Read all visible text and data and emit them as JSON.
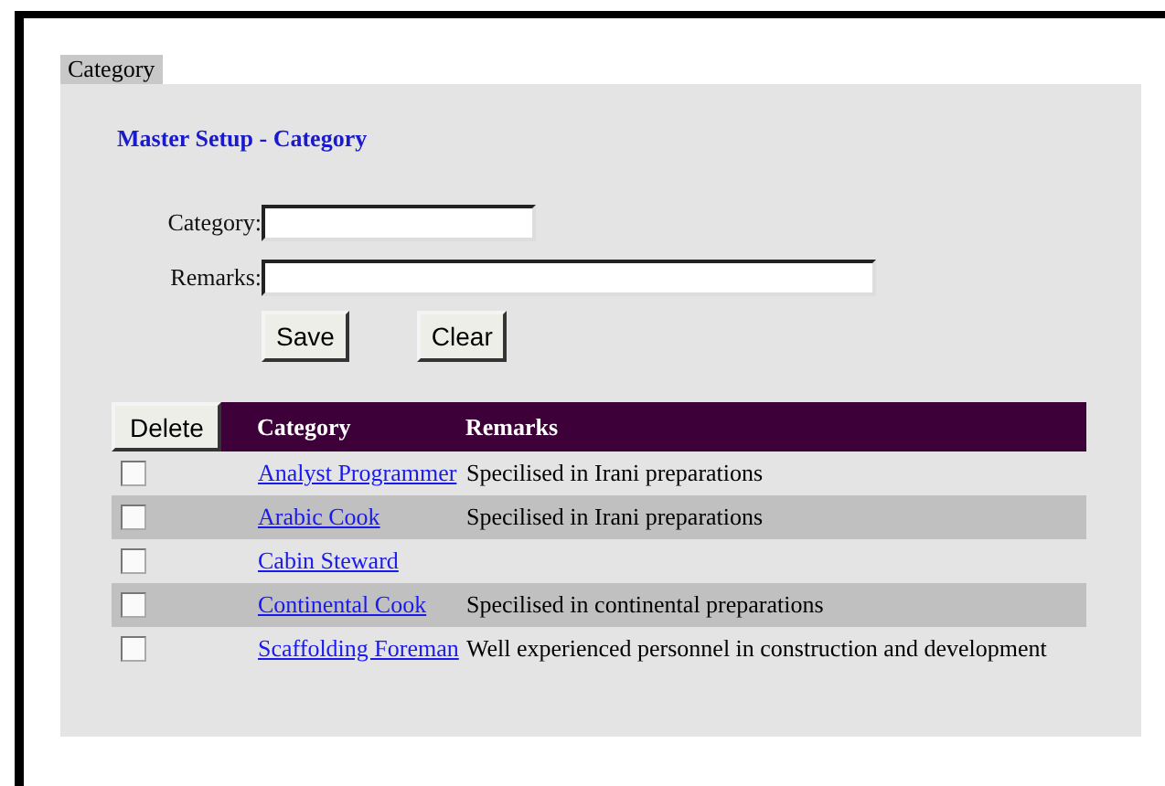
{
  "tab": {
    "label": "Category",
    "selected": true
  },
  "heading": "Master Setup - Category",
  "form": {
    "fields": [
      {
        "label": "Category:"
      },
      {
        "label": "Remarks:"
      }
    ],
    "buttons": [
      "Save",
      "Clear"
    ]
  },
  "table": {
    "delete_button": "Delete",
    "columns": [
      "Category",
      "Remarks"
    ],
    "rows": [
      {
        "checked": false,
        "category": "Analyst Programmer",
        "remarks": "Specilised in Irani preparations"
      },
      {
        "checked": false,
        "category": "Arabic Cook",
        "remarks": "Specilised in Irani preparations"
      },
      {
        "checked": false,
        "category": "Cabin Steward"
      },
      {
        "checked": false,
        "category": "Continental Cook",
        "remarks": "Specilised in continental preparations"
      },
      {
        "checked": false,
        "category": "Scaffolding Foreman",
        "remarks": "Well experienced personnel in construction and development"
      }
    ]
  }
}
